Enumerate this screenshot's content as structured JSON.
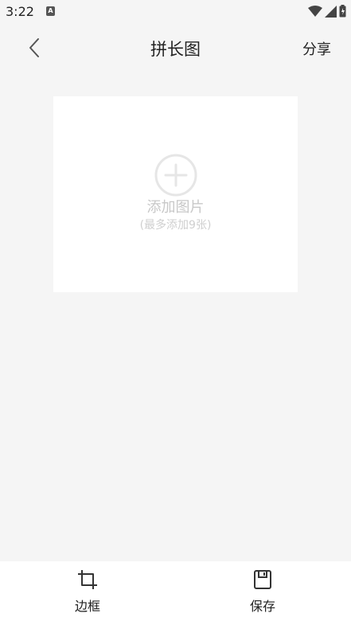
{
  "status_bar": {
    "time": "3:22",
    "notification_icon": "a-icon",
    "wifi_icon": "wifi-icon",
    "signal_icon": "signal-icon",
    "battery_icon": "battery-icon"
  },
  "header": {
    "back_icon": "chevron-left-icon",
    "title": "拼长图",
    "share_label": "分享"
  },
  "canvas": {
    "add_icon": "plus-circle-icon",
    "add_label": "添加图片",
    "add_hint": "(最多添加9张)"
  },
  "bottom_bar": {
    "items": [
      {
        "icon": "crop-icon",
        "label": "边框"
      },
      {
        "icon": "save-icon",
        "label": "保存"
      }
    ]
  },
  "colors": {
    "background": "#f5f5f5",
    "card": "#ffffff",
    "placeholder_text": "#c8c8c8"
  }
}
